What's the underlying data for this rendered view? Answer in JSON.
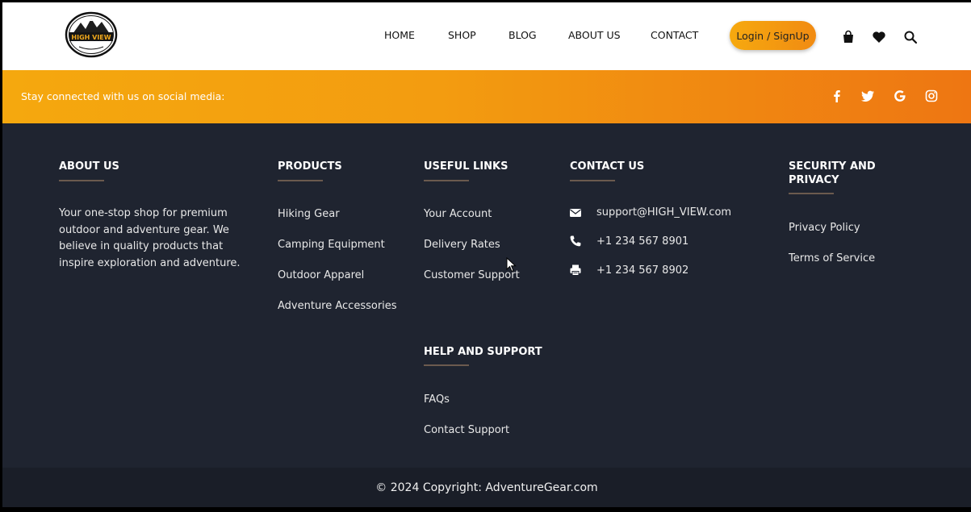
{
  "header": {
    "logo_text": "HIGH VIEW",
    "nav": [
      {
        "label": "HOME"
      },
      {
        "label": "SHOP"
      },
      {
        "label": "BLOG"
      },
      {
        "label": "ABOUT US"
      },
      {
        "label": "CONTACT"
      }
    ],
    "login_label": "Login / SignUp",
    "icons": [
      "shopping-bag-icon",
      "heart-icon",
      "search-icon"
    ]
  },
  "social_bar": {
    "text": "Stay connected with us on social media:",
    "icons": [
      "facebook-icon",
      "twitter-icon",
      "google-icon",
      "instagram-icon"
    ]
  },
  "footer": {
    "about": {
      "title": "ABOUT US",
      "text": "Your one-stop shop for premium outdoor and adventure gear. We believe in quality products that inspire exploration and adventure."
    },
    "products": {
      "title": "PRODUCTS",
      "items": [
        "Hiking Gear",
        "Camping Equipment",
        "Outdoor Apparel",
        "Adventure Accessories"
      ]
    },
    "useful_links": {
      "title": "USEFUL LINKS",
      "items": [
        "Your Account",
        "Delivery Rates",
        "Customer Support"
      ]
    },
    "help": {
      "title": "HELP AND SUPPORT",
      "items": [
        "FAQs",
        "Contact Support"
      ]
    },
    "contact": {
      "title": "CONTACT US",
      "email": "support@HIGH_VIEW.com",
      "phone": "+1 234 567 8901",
      "fax": "+1 234 567 8902"
    },
    "security": {
      "title_line1": "SECURITY AND",
      "title_line2": "PRIVACY",
      "items": [
        "Privacy Policy",
        "Terms of Service"
      ]
    }
  },
  "copyright": "© 2024 Copyright: AdventureGear.com",
  "colors": {
    "accent_orange": "#f39c10",
    "footer_bg": "#1f2430",
    "bottom_bg": "#1a1e28"
  }
}
